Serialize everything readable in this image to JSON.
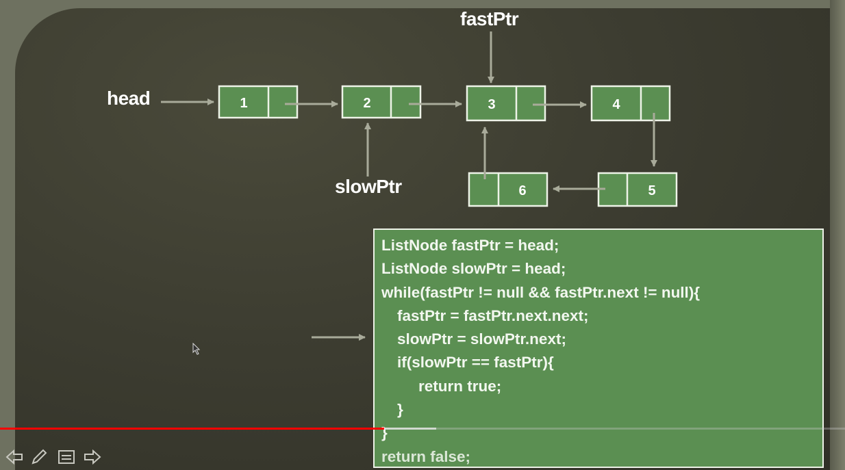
{
  "labels": {
    "head": "head",
    "fast_ptr": "fastPtr",
    "slow_ptr": "slowPtr"
  },
  "nodes": [
    {
      "value": "1"
    },
    {
      "value": "2"
    },
    {
      "value": "3"
    },
    {
      "value": "4"
    },
    {
      "value": "5"
    },
    {
      "value": "6"
    }
  ],
  "code": [
    "ListNode fastPtr = head;",
    "ListNode slowPtr = head;",
    "while(fastPtr != null && fastPtr.next != null){",
    "fastPtr = fastPtr.next.next;",
    "slowPtr = slowPtr.next;",
    "if(slowPtr == fastPtr){",
    "return true;",
    "}",
    "}",
    "return false;"
  ],
  "player": {
    "played_fraction": 0.455,
    "buffered_fraction": 0.516,
    "controls": [
      "prev-icon",
      "pen-icon",
      "menu-icon",
      "next-icon"
    ]
  },
  "colors": {
    "node_fill": "#5b8f52",
    "node_border": "#eef3e8",
    "arrow": "#a9ab9a",
    "progress": "#ff0000"
  }
}
